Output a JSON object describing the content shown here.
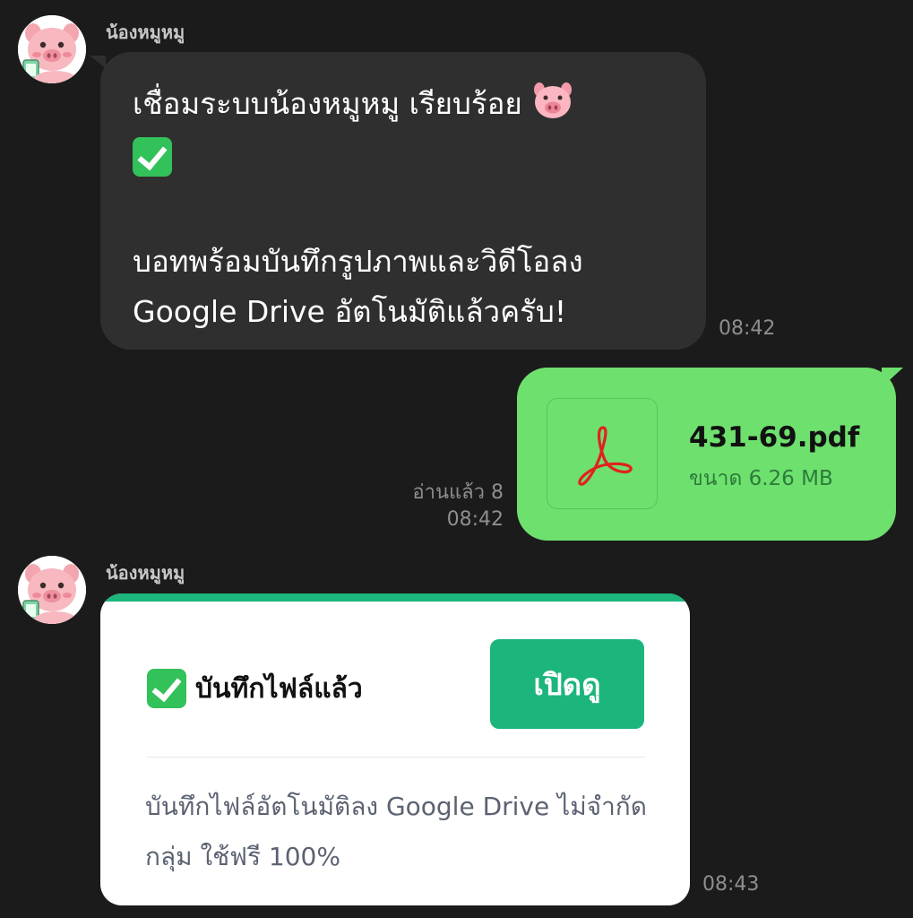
{
  "messages": [
    {
      "type": "incoming_text",
      "sender": "น้องหมูหมู",
      "line1": "เชื่อมระบบน้องหมูหมู เรียบร้อย",
      "line2": "บอทพร้อมบันทึกรูปภาพและวิดีโอลง",
      "line3": "Google Drive อัตโนมัติแล้วครับ!",
      "emojis": [
        "pig-face-icon",
        "check-mark-button-icon"
      ],
      "time": "08:42"
    },
    {
      "type": "outgoing_file",
      "file_name": "431-69.pdf",
      "file_size": "ขนาด 6.26 MB",
      "file_icon": "pdf-icon",
      "read_status": "อ่านแล้ว 8",
      "time": "08:42"
    },
    {
      "type": "incoming_card",
      "sender": "น้องหมูหมู",
      "title": "บันทึกไฟล์แล้ว",
      "button_label": "เปิดดู",
      "description": "บันทึกไฟล์อัตโนมัติลง Google Drive ไม่จำกัดกลุ่ม ใช้ฟรี 100%",
      "time": "08:43"
    }
  ],
  "colors": {
    "background": "#1b1b1b",
    "incoming_bubble": "#2f2f2f",
    "outgoing_bubble": "#6ee06e",
    "card_accent": "#1cb57c",
    "pdf_red": "#e0221f"
  }
}
